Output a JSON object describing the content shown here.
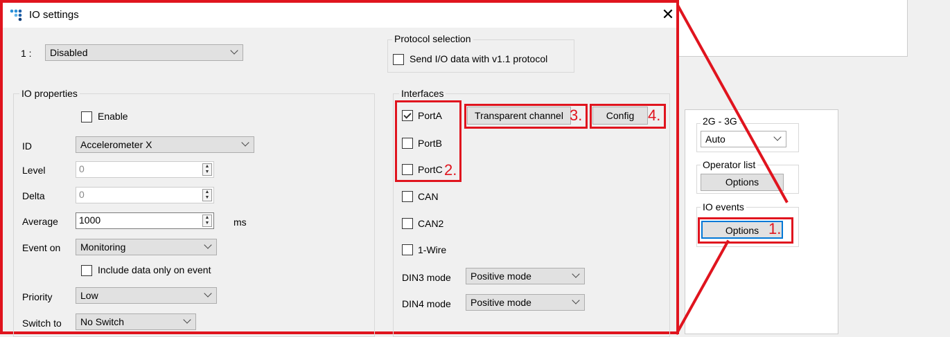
{
  "dialog": {
    "title": "IO settings",
    "close_symbol": "✕",
    "io_index_label": "1 :",
    "io_mode": "Disabled"
  },
  "protocol": {
    "group_title": "Protocol selection",
    "checkbox_label": "Send I/O data with v1.1 protocol",
    "checked": false
  },
  "io_properties": {
    "group_title": "IO properties",
    "enable_label": "Enable",
    "id_label": "ID",
    "id_value": "Accelerometer X",
    "level_label": "Level",
    "level_value": "0",
    "delta_label": "Delta",
    "delta_value": "0",
    "average_label": "Average",
    "average_value": "1000",
    "average_unit": "ms",
    "event_on_label": "Event on",
    "event_on_value": "Monitoring",
    "include_label": "Include data only on event",
    "priority_label": "Priority",
    "priority_value": "Low",
    "switch_to_label": "Switch to",
    "switch_to_value": "No Switch"
  },
  "interfaces": {
    "group_title": "Interfaces",
    "porta": "PortA",
    "portb": "PortB",
    "portc": "PortC",
    "can": "CAN",
    "can2": "CAN2",
    "onewire": "1-Wire",
    "transparent_channel": "Transparent channel",
    "config": "Config",
    "din3_label": "DIN3 mode",
    "din3_value": "Positive mode",
    "din4_label": "DIN4 mode",
    "din4_value": "Positive mode"
  },
  "right_panel": {
    "network_group": "2G - 3G",
    "network_value": "Auto",
    "operator_group": "Operator list",
    "operator_button": "Options",
    "io_events_group": "IO events",
    "io_events_button": "Options"
  },
  "annotations": {
    "step1": "1.",
    "step2": "2.",
    "step3": "3.",
    "step4": "4."
  },
  "colors": {
    "highlight": "#e0141e",
    "button_focus": "#0078d7"
  },
  "icons": [
    "app-logo-icon",
    "close-icon",
    "chevron-down-icon",
    "checkmark-icon",
    "spin-arrows-icon"
  ]
}
